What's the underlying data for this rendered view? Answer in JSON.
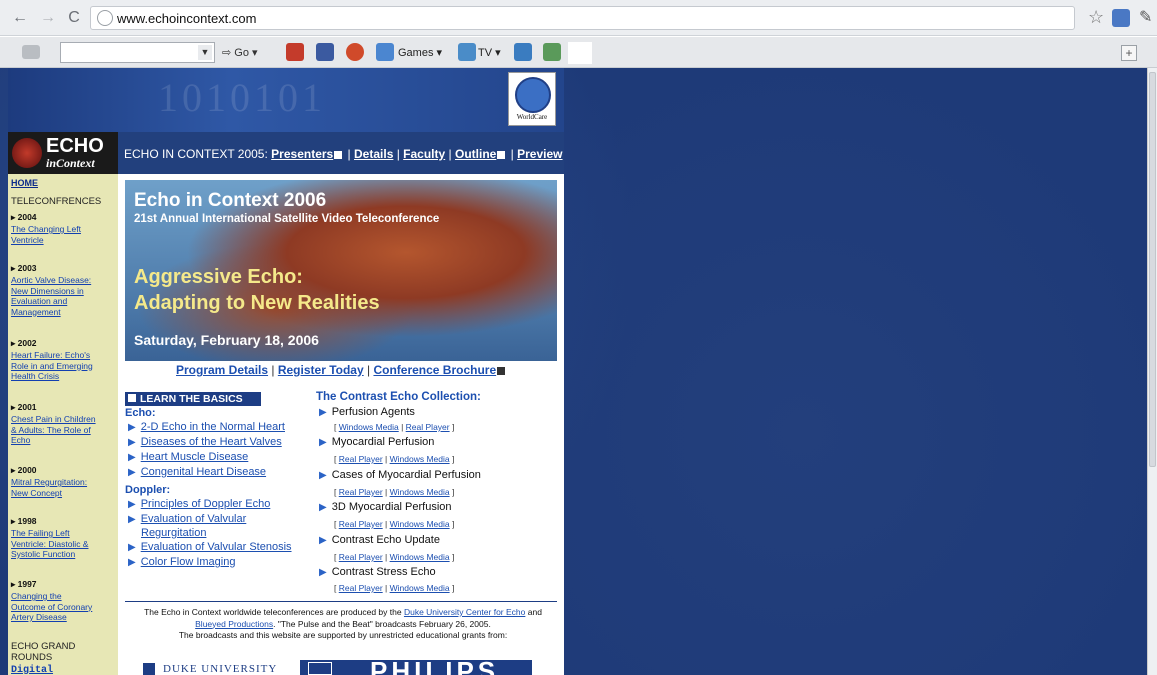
{
  "browser": {
    "url": "www.echoincontext.com",
    "go_label": "Go",
    "games_label": "Games",
    "tv_label": "TV"
  },
  "header": {
    "binary_text": "1010101",
    "worldcare_label": "WorldCare"
  },
  "brand": {
    "logo_line1": "ECHO",
    "logo_line2": "inContext",
    "nav_prefix": "ECHO IN CONTEXT 2005:",
    "nav_links": [
      "Presenters",
      "Details",
      "Faculty",
      "Outline",
      "Preview"
    ]
  },
  "sidebar": {
    "home": "HOME",
    "teleconf_heading": "TELECONFRENCES",
    "items": [
      {
        "year": "▸ 2004",
        "title_lines": [
          "The Changing Left",
          "Ventricle"
        ]
      },
      {
        "year": "▸ 2003",
        "title_lines": [
          "Aortic Valve Disease:",
          "New Dimensions in",
          "Evaluation and",
          "Management"
        ]
      },
      {
        "year": "▸ 2002",
        "title_lines": [
          "Heart Failure: Echo's",
          "Role in and Emerging",
          "Health Crisis"
        ]
      },
      {
        "year": "▸ 2001",
        "title_lines": [
          "Chest Pain in Children",
          "& Adults: The Role of",
          "Echo"
        ]
      },
      {
        "year": "▸ 2000",
        "title_lines": [
          "Mitral Regurgitation:",
          "New Concept"
        ]
      },
      {
        "year": "▸ 1998",
        "title_lines": [
          "The Failing Left",
          "Ventricle: Diastolic &",
          "Systolic Function"
        ]
      },
      {
        "year": "▸ 1997",
        "title_lines": [
          "Changing the",
          "Outcome of Coronary",
          "Artery Disease"
        ]
      }
    ],
    "grand_rounds_line1": "ECHO GRAND",
    "grand_rounds_line2": "ROUNDS",
    "digital_integration": "Digital Integration"
  },
  "banner": {
    "title": "Echo in Context 2006",
    "subtitle": "21st Annual International Satellite Video Teleconference",
    "headline1": "Aggressive Echo:",
    "headline2": "Adapting to New Realities",
    "date": "Saturday, February 18, 2006"
  },
  "program_links": {
    "details": "Program Details",
    "register": "Register Today",
    "brochure": "Conference Brochure"
  },
  "learn": {
    "heading": "LEARN THE BASICS",
    "echo_label": "Echo:",
    "echo_links": [
      "2-D Echo in the Normal Heart",
      "Diseases of the Heart Valves",
      "Heart Muscle Disease",
      "Congenital Heart Disease"
    ],
    "doppler_label": "Doppler:",
    "doppler_links": [
      "Principles of Doppler Echo",
      "Evaluation of Valvular",
      "Regurgitation",
      "Evaluation of Valvular Stenosis",
      "Color Flow Imaging"
    ]
  },
  "contrast": {
    "heading": "The Contrast Echo Collection:",
    "items": [
      {
        "title": "Perfusion Agents",
        "media": [
          "Windows Media",
          "Real Player"
        ]
      },
      {
        "title": "Myocardial Perfusion",
        "media": [
          "Real Player",
          "Windows Media"
        ]
      },
      {
        "title": "Cases of Myocardial Perfusion",
        "media": [
          "Real Player",
          "Windows Media"
        ]
      },
      {
        "title": "3D Myocardial Perfusion",
        "media": [
          "Real Player",
          "Windows Media"
        ]
      },
      {
        "title": "Contrast Echo Update",
        "media": [
          "Real Player",
          "Windows Media"
        ]
      },
      {
        "title": "Contrast Stress Echo",
        "media": [
          "Real Player",
          "Windows Media"
        ]
      }
    ]
  },
  "footer": {
    "line1_pre": "The Echo in Context worldwide teleconferences are produced by the",
    "duke_link": "Duke University Center for Echo",
    "and": "and",
    "blueyed_link": "Blueyed Productions",
    "line2_rest": ". \"The Pulse and the Beat\" broadcasts February 26, 2005.",
    "line3": "The broadcasts and this website are supported by unrestricted educational grants from:",
    "duke_logo": "DUKE UNIVERSITY",
    "philips_logo": "PHILIPS"
  },
  "colors": {
    "accent_blue": "#1c4fb0",
    "header_navy": "#1d3d84",
    "sidebar_bg": "#e7e7b5",
    "banner_yellow": "#f5e98a"
  }
}
